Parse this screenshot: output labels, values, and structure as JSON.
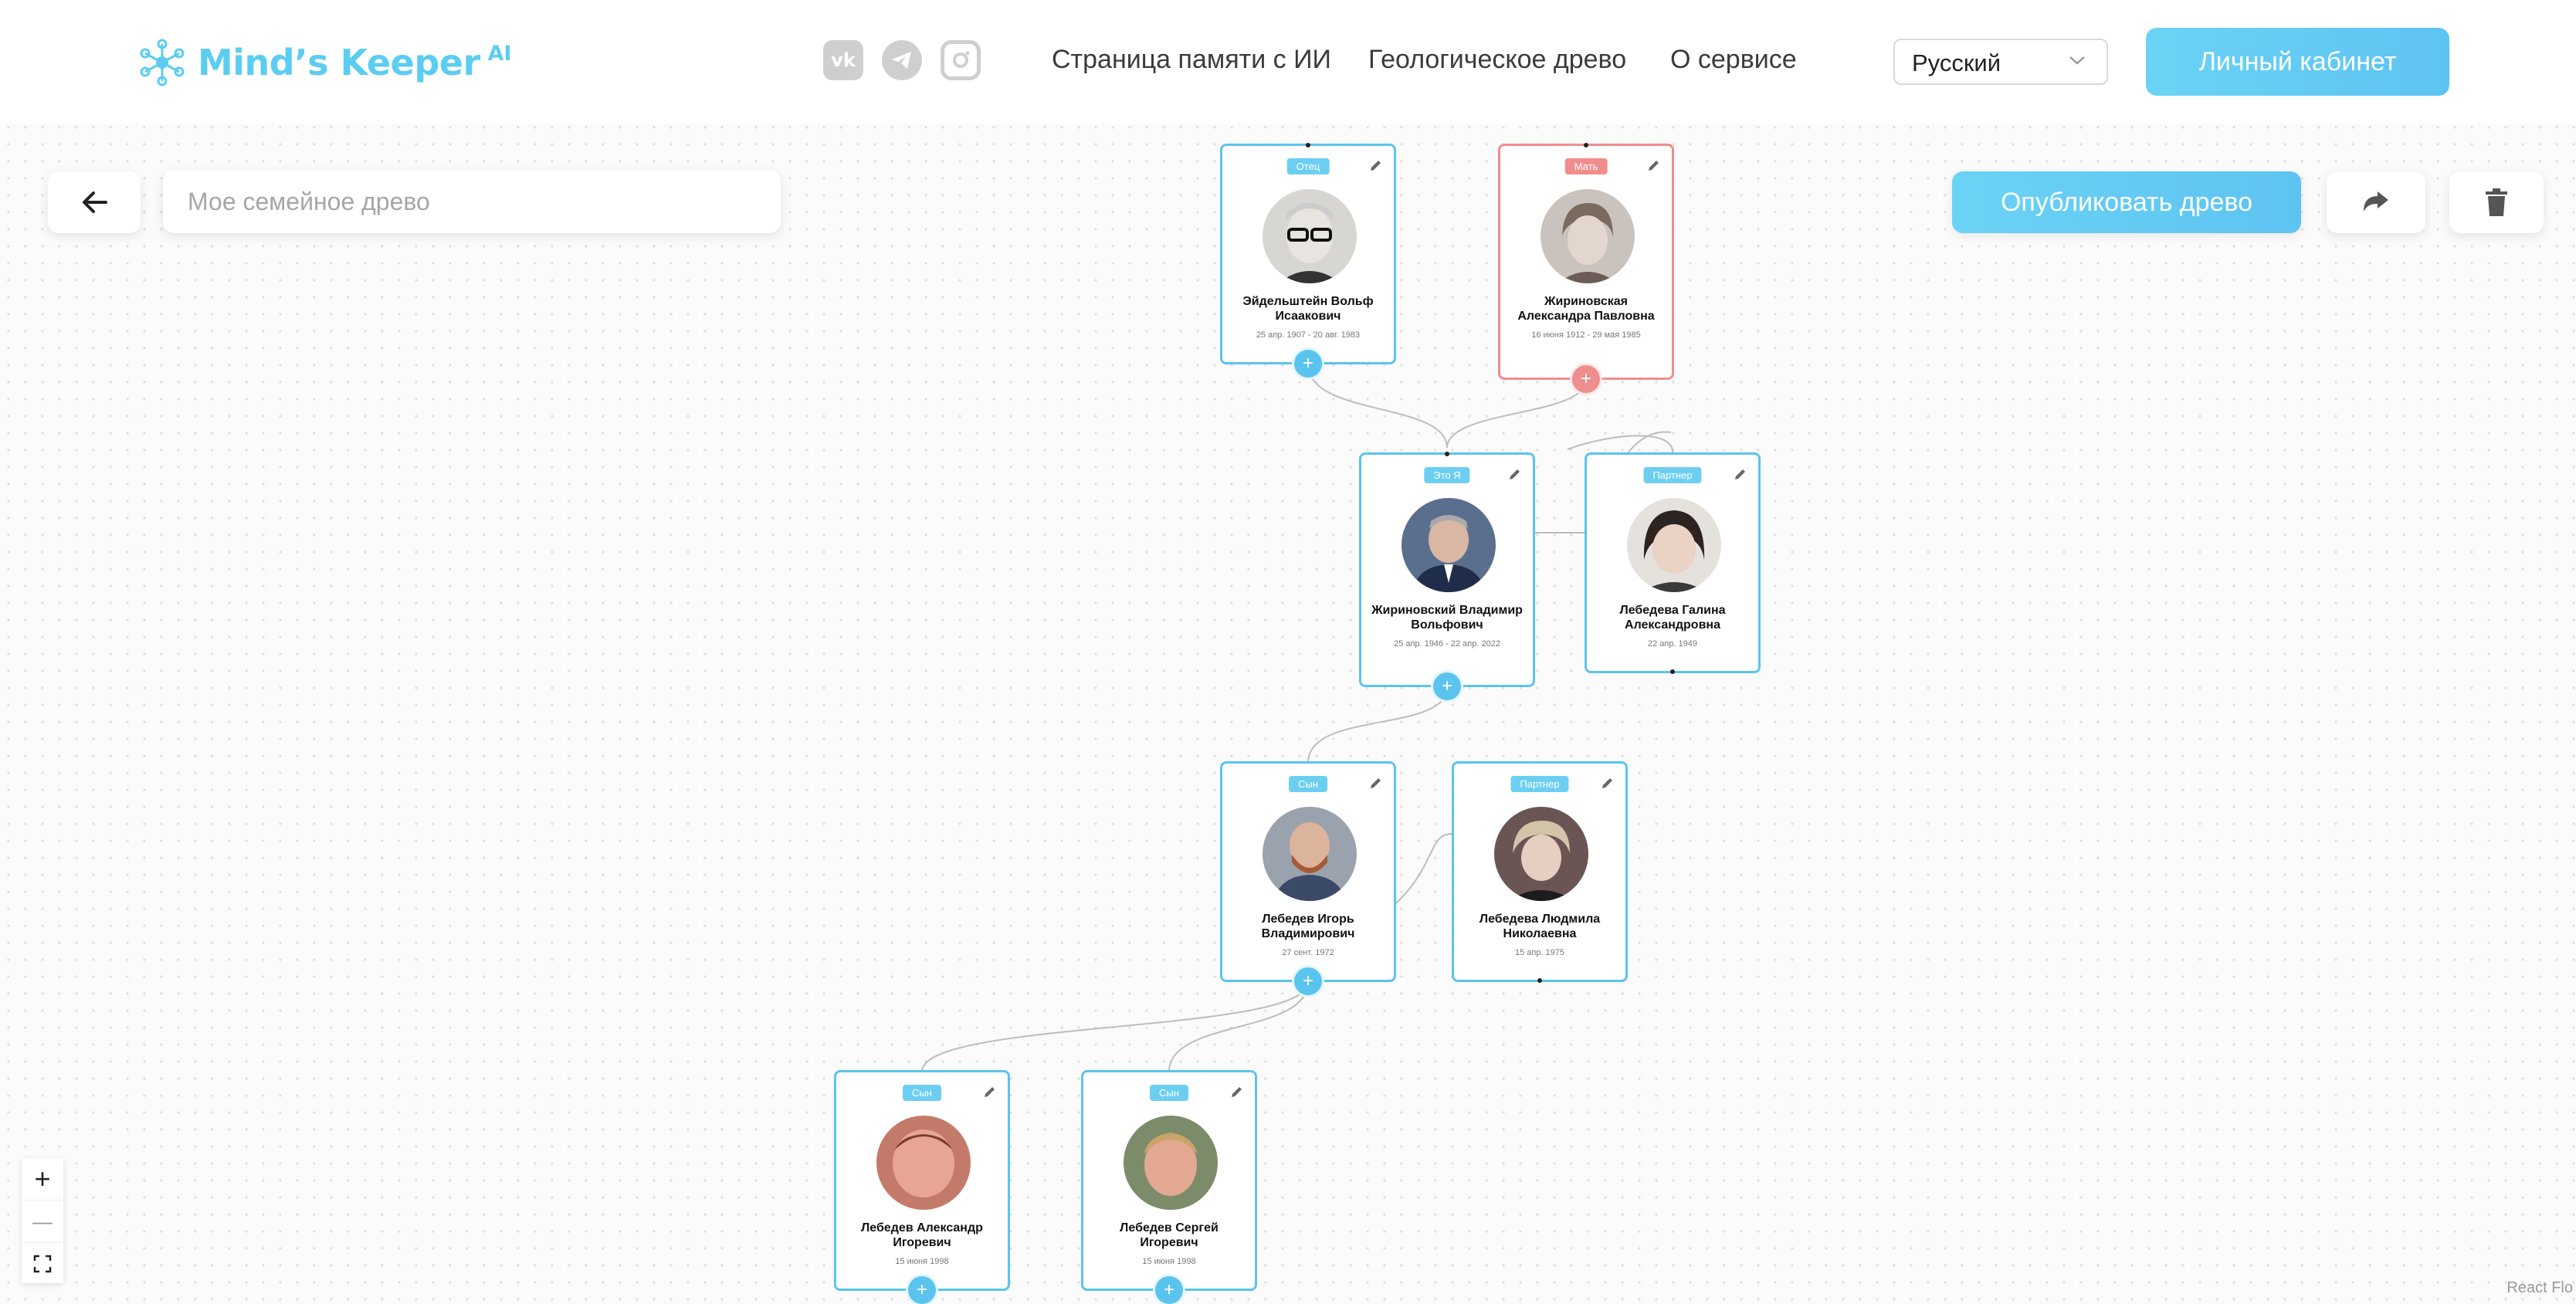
{
  "brand": {
    "name": "Mind’s Keeper",
    "suffix": "AI",
    "color": "#5ccdf2"
  },
  "social": {
    "vk": "vk-icon",
    "telegram": "telegram-icon",
    "instagram": "instagram-icon"
  },
  "nav": {
    "memorial_page": "Страница памяти с ИИ",
    "tree": "Геологическое древо",
    "about": "О сервисе"
  },
  "language": {
    "selected": "Русский"
  },
  "cabinet_label": "Личный кабинет",
  "toolbar": {
    "tree_name_placeholder": "Мое семейное древо",
    "publish_label": "Опубликовать древо"
  },
  "colors": {
    "accent": "#5bc4ee",
    "mother": "#ef8e8e"
  },
  "people": {
    "father": {
      "role": "Отец",
      "name": "Эйдельштейн Вольф Исаакович",
      "dates": "25 апр. 1907 - 20 авг. 1983"
    },
    "mother": {
      "role": "Мать",
      "name": "Жириновская Александра Павловна",
      "dates": "16 июня 1912 - 29 мая 1985"
    },
    "me": {
      "role": "Это Я",
      "name": "Жириновский Владимир Вольфович",
      "dates": "25 апр. 1946 - 22 апр. 2022"
    },
    "partner1": {
      "role": "Партнер",
      "name": "Лебедева Галина Александровна",
      "dates": "22 апр. 1949"
    },
    "son": {
      "role": "Сын",
      "name": "Лебедев Игорь Владимирович",
      "dates": "27 сент. 1972"
    },
    "partner2": {
      "role": "Партнер",
      "name": "Лебедева Людмила Николаевна",
      "dates": "15 апр. 1975"
    },
    "grandson1": {
      "role": "Сын",
      "name": "Лебедев Александр Игоревич",
      "dates": "15 июня 1998"
    },
    "grandson2": {
      "role": "Сын",
      "name": "Лебедев Сергей Игоревич",
      "dates": "15 июня 1998"
    }
  },
  "add_symbol": "+",
  "zoom": {
    "in": "+",
    "out": "—"
  },
  "attribution": "React Flo"
}
